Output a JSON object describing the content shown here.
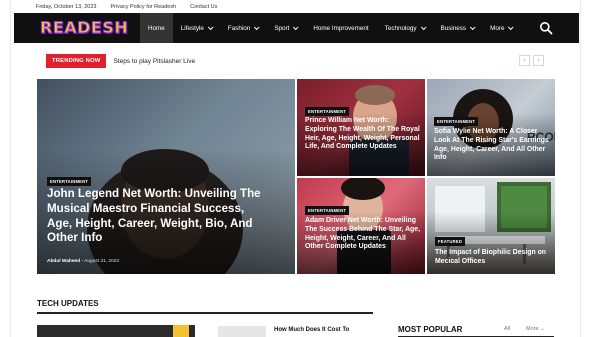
{
  "topbar": {
    "date": "Friday, October 13, 2023",
    "links": [
      "Privacy Policy for Readesh",
      "Contact Us"
    ]
  },
  "logo": {
    "text": "READESH"
  },
  "nav": {
    "items": [
      {
        "label": "Home",
        "dropdown": false,
        "active": true
      },
      {
        "label": "Lifestyle",
        "dropdown": true
      },
      {
        "label": "Fashion",
        "dropdown": true
      },
      {
        "label": "Sport",
        "dropdown": true
      },
      {
        "label": "Home Improvement",
        "dropdown": false
      },
      {
        "label": "Technology",
        "dropdown": true
      },
      {
        "label": "Business",
        "dropdown": true
      },
      {
        "label": "More",
        "dropdown": true
      }
    ],
    "search_icon": "search-icon"
  },
  "trending": {
    "badge": "TRENDING NOW",
    "headline": "Steps to play Pitslasher Live",
    "prev_icon": "chevron-left-icon",
    "next_icon": "chevron-right-icon"
  },
  "featured": [
    {
      "category": "ENTERTAINMENT",
      "title": "John Legend Net Worth: Unveiling The Musical Maestro Financial Success, Age, Height, Career, Weight, Bio, And Other Info",
      "author": "Abdul Waheed",
      "date": "August 31, 2023"
    },
    {
      "category": "ENTERTAINMENT",
      "title": "Prince William Net Worth: Exploring The Wealth Of The Royal Heir, Age, Height, Weight, Personal Life, And Complete Updates"
    },
    {
      "category": "ENTERTAINMENT",
      "title": "Sofia Wylie Net Worth: A Closer Look At The Rising Star's Earnings Age, Height, Career, And All Other Info"
    },
    {
      "category": "ENTERTAINMENT",
      "title": "Adam Driver Net Worth: Unveiling The Success Behind The Star, Age, Height, Weight, Career, And All Other Complete Updates"
    },
    {
      "category": "FEATURED",
      "title": "The Impact of Biophilic Design on Mecical Offices"
    }
  ],
  "tech_updates": {
    "heading": "TECH UPDATES",
    "first_title": "How Much Does It Cost To"
  },
  "most_popular": {
    "heading": "MOST POPULAR",
    "filter_all": "All",
    "filter_more": "More"
  },
  "colors": {
    "nav_bg": "#101010",
    "trending_red": "#e0212d",
    "logo_yellow": "#f6c23a",
    "logo_purple": "#8a2be2"
  }
}
